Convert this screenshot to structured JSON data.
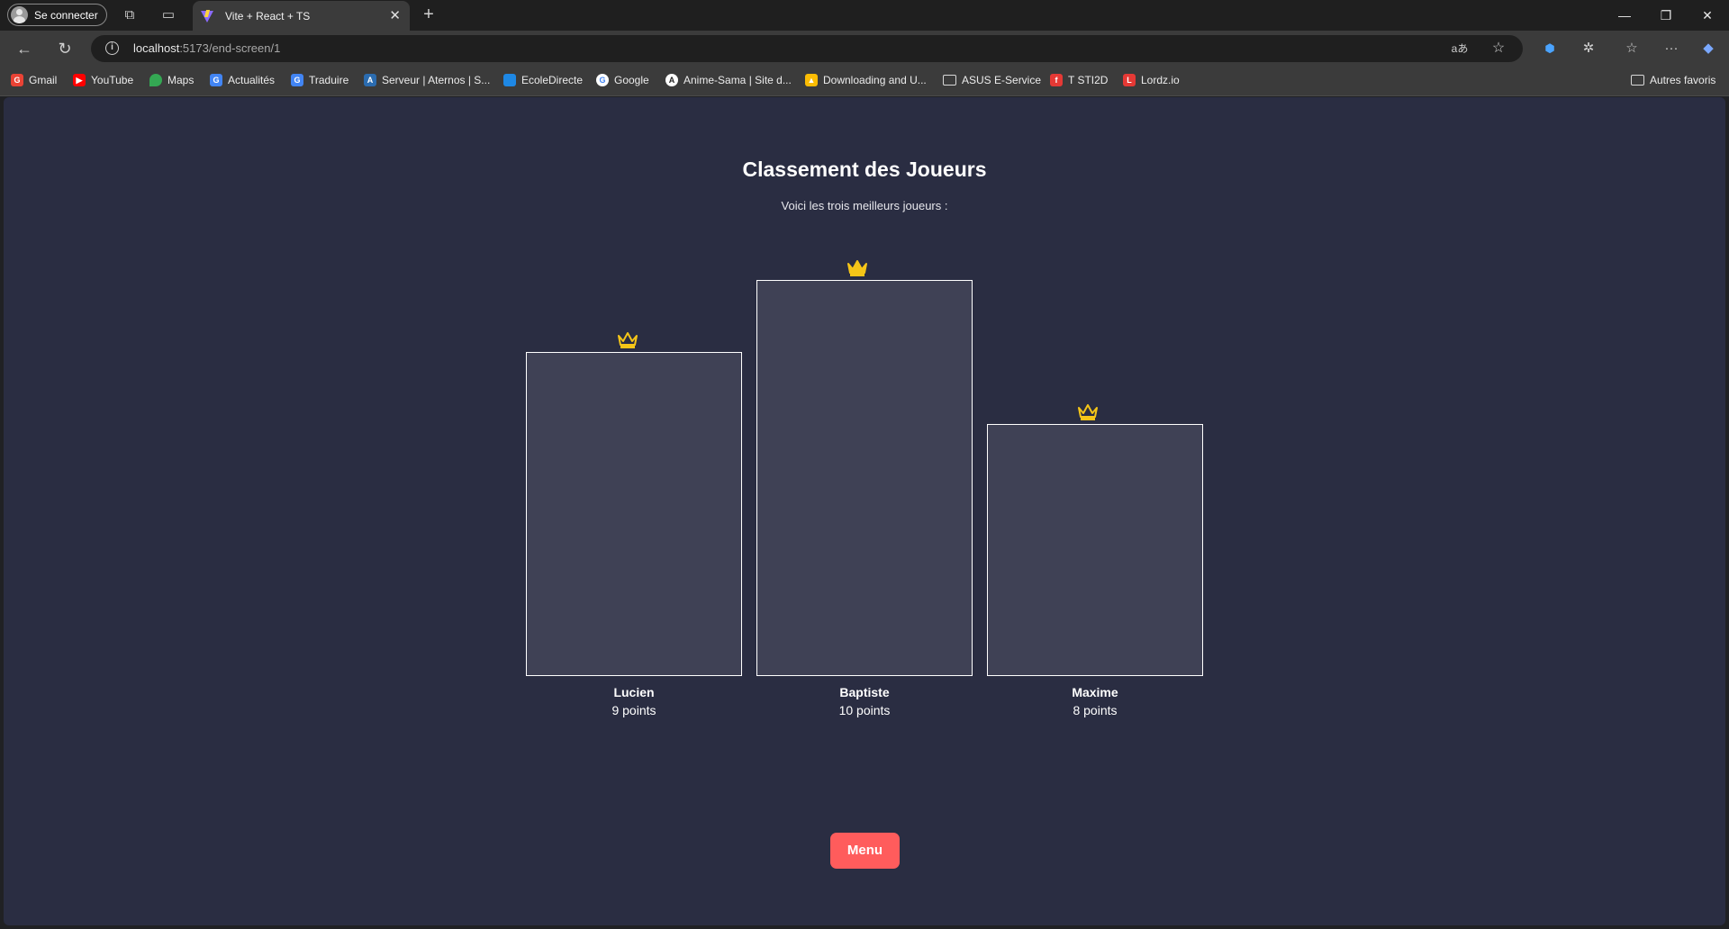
{
  "browser": {
    "profile_label": "Se connecter",
    "tab_title": "Vite + React + TS",
    "url_host": "localhost",
    "url_path": ":5173/end-screen/1",
    "autres_favoris": "Autres favoris",
    "bookmarks": [
      {
        "label": "Gmail",
        "icon": "gmail-icon",
        "color": "#ea4335"
      },
      {
        "label": "YouTube",
        "icon": "youtube-icon",
        "color": "#ff0000"
      },
      {
        "label": "Maps",
        "icon": "maps-icon",
        "color": "#34a853"
      },
      {
        "label": "Actualités",
        "icon": "news-icon",
        "color": "#4285f4"
      },
      {
        "label": "Traduire",
        "icon": "translate-icon",
        "color": "#4285f4"
      },
      {
        "label": "Serveur | Aternos | S...",
        "icon": "aternos-icon",
        "color": "#2b6cb0"
      },
      {
        "label": "EcoleDirecte",
        "icon": "ecoledirecte-icon",
        "color": "#1e88e5"
      },
      {
        "label": "Google",
        "icon": "google-icon",
        "color": "#ffffff"
      },
      {
        "label": "Anime-Sama | Site d...",
        "icon": "anime-sama-icon",
        "color": "#ffffff"
      },
      {
        "label": "Downloading and U...",
        "icon": "drive-icon",
        "color": "#fbbc04"
      },
      {
        "label": "ASUS E-Service",
        "icon": "folder-icon",
        "color": "#d8d8d8"
      },
      {
        "label": "T STI2D",
        "icon": "flash-icon",
        "color": "#e53935"
      },
      {
        "label": "Lordz.io",
        "icon": "lordz-icon",
        "color": "#e53935"
      }
    ]
  },
  "page": {
    "title": "Classement des Joueurs",
    "subtitle": "Voici les trois meilleurs joueurs :",
    "menu_label": "Menu",
    "accent_color": "#ff5c5c",
    "crown_color": "#f5c518"
  },
  "players": [
    {
      "name": "Lucien",
      "score": "9 points",
      "points": 9
    },
    {
      "name": "Baptiste",
      "score": "10 points",
      "points": 10
    },
    {
      "name": "Maxime",
      "score": "8 points",
      "points": 8
    }
  ]
}
